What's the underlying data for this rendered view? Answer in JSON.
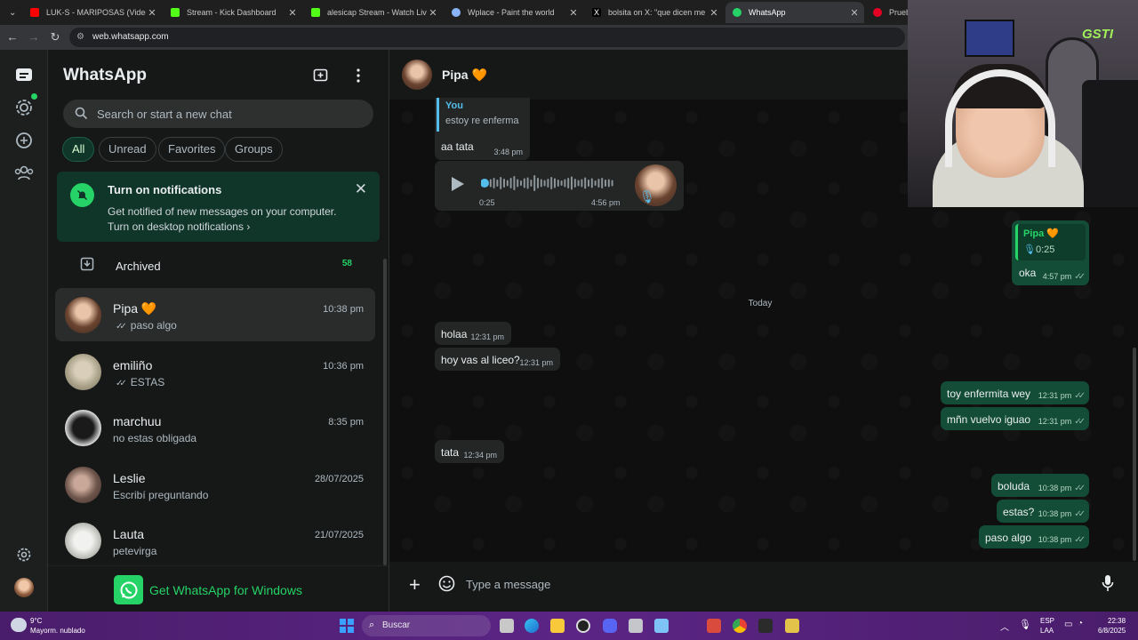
{
  "browser": {
    "tabs": [
      {
        "title": "LUK-S - MARIPOSAS (Video Oficial)",
        "color": "#ff0000"
      },
      {
        "title": "Stream - Kick Dashboard",
        "color": "#53fc18"
      },
      {
        "title": "alesicap Stream - Watch Live on Kick",
        "color": "#53fc18"
      },
      {
        "title": "Wplace - Paint the world",
        "color": "#8ab4f8"
      },
      {
        "title": "bolsita on X: \"que dicen me saco",
        "color": "#ffffff"
      },
      {
        "title": "WhatsApp",
        "color": "#25d366"
      },
      {
        "title": "Prueba",
        "color": "#e60023"
      }
    ],
    "url": "web.whatsapp.com"
  },
  "sidebar": {
    "title": "WhatsApp",
    "search_placeholder": "Search or start a new chat",
    "filters": [
      "All",
      "Unread",
      "Favorites",
      "Groups"
    ],
    "notification": {
      "title": "Turn on notifications",
      "body": "Get notified of new messages on your computer.",
      "link": "Turn on desktop notifications"
    },
    "archived_label": "Archived",
    "archived_count": "58",
    "chats": [
      {
        "name": "Pipa 🧡",
        "time": "10:38 pm",
        "preview": "paso algo",
        "ticks": true
      },
      {
        "name": "emiliño",
        "time": "10:36 pm",
        "preview": "ESTAS",
        "ticks": true
      },
      {
        "name": "marchuu",
        "time": "8:35 pm",
        "preview": "no estas obligada",
        "ticks": false
      },
      {
        "name": "Leslie",
        "time": "28/07/2025",
        "preview": "Escribí preguntando",
        "ticks": false
      },
      {
        "name": "Lauta",
        "time": "21/07/2025",
        "preview": "petevirga",
        "ticks": false
      }
    ],
    "get_app": "Get WhatsApp for Windows"
  },
  "chat": {
    "contact": "Pipa 🧡",
    "quote_in": {
      "author": "You",
      "text": "estoy re enferma"
    },
    "messages_in_top": [
      {
        "text": "aa tata",
        "time": "3:48 pm"
      }
    ],
    "voice": {
      "duration": "0:25",
      "time": "4:56 pm"
    },
    "quote_out": {
      "author": "Pipa 🧡",
      "text": "0:25"
    },
    "reply_out": {
      "text": "oka",
      "time": "4:57 pm"
    },
    "day_label": "Today",
    "in_msgs": [
      {
        "text": "holaa",
        "time": "12:31 pm"
      },
      {
        "text": "hoy vas al liceo?",
        "time": "12:31 pm"
      },
      {
        "text": "tata",
        "time": "12:34 pm"
      }
    ],
    "out_msgs": [
      {
        "text": "toy enfermita wey",
        "time": "12:31 pm"
      },
      {
        "text": "mñn vuelvo iguao",
        "time": "12:31 pm"
      },
      {
        "text": "boluda",
        "time": "10:38 pm"
      },
      {
        "text": "estas?",
        "time": "10:38 pm"
      },
      {
        "text": "paso algo",
        "time": "10:38 pm"
      }
    ],
    "composer_placeholder": "Type a message"
  },
  "webcam": {
    "logo": "GSTI"
  },
  "taskbar": {
    "weather_temp": "9°C",
    "weather_desc": "Mayorm. nublado",
    "search": "Buscar",
    "lang": "ESP",
    "lang2": "LAA",
    "time": "22:38",
    "date": "6/8/2025"
  },
  "colors": {
    "accent": "#25d366",
    "out_bubble": "#144d37",
    "in_bubble": "#242626"
  }
}
